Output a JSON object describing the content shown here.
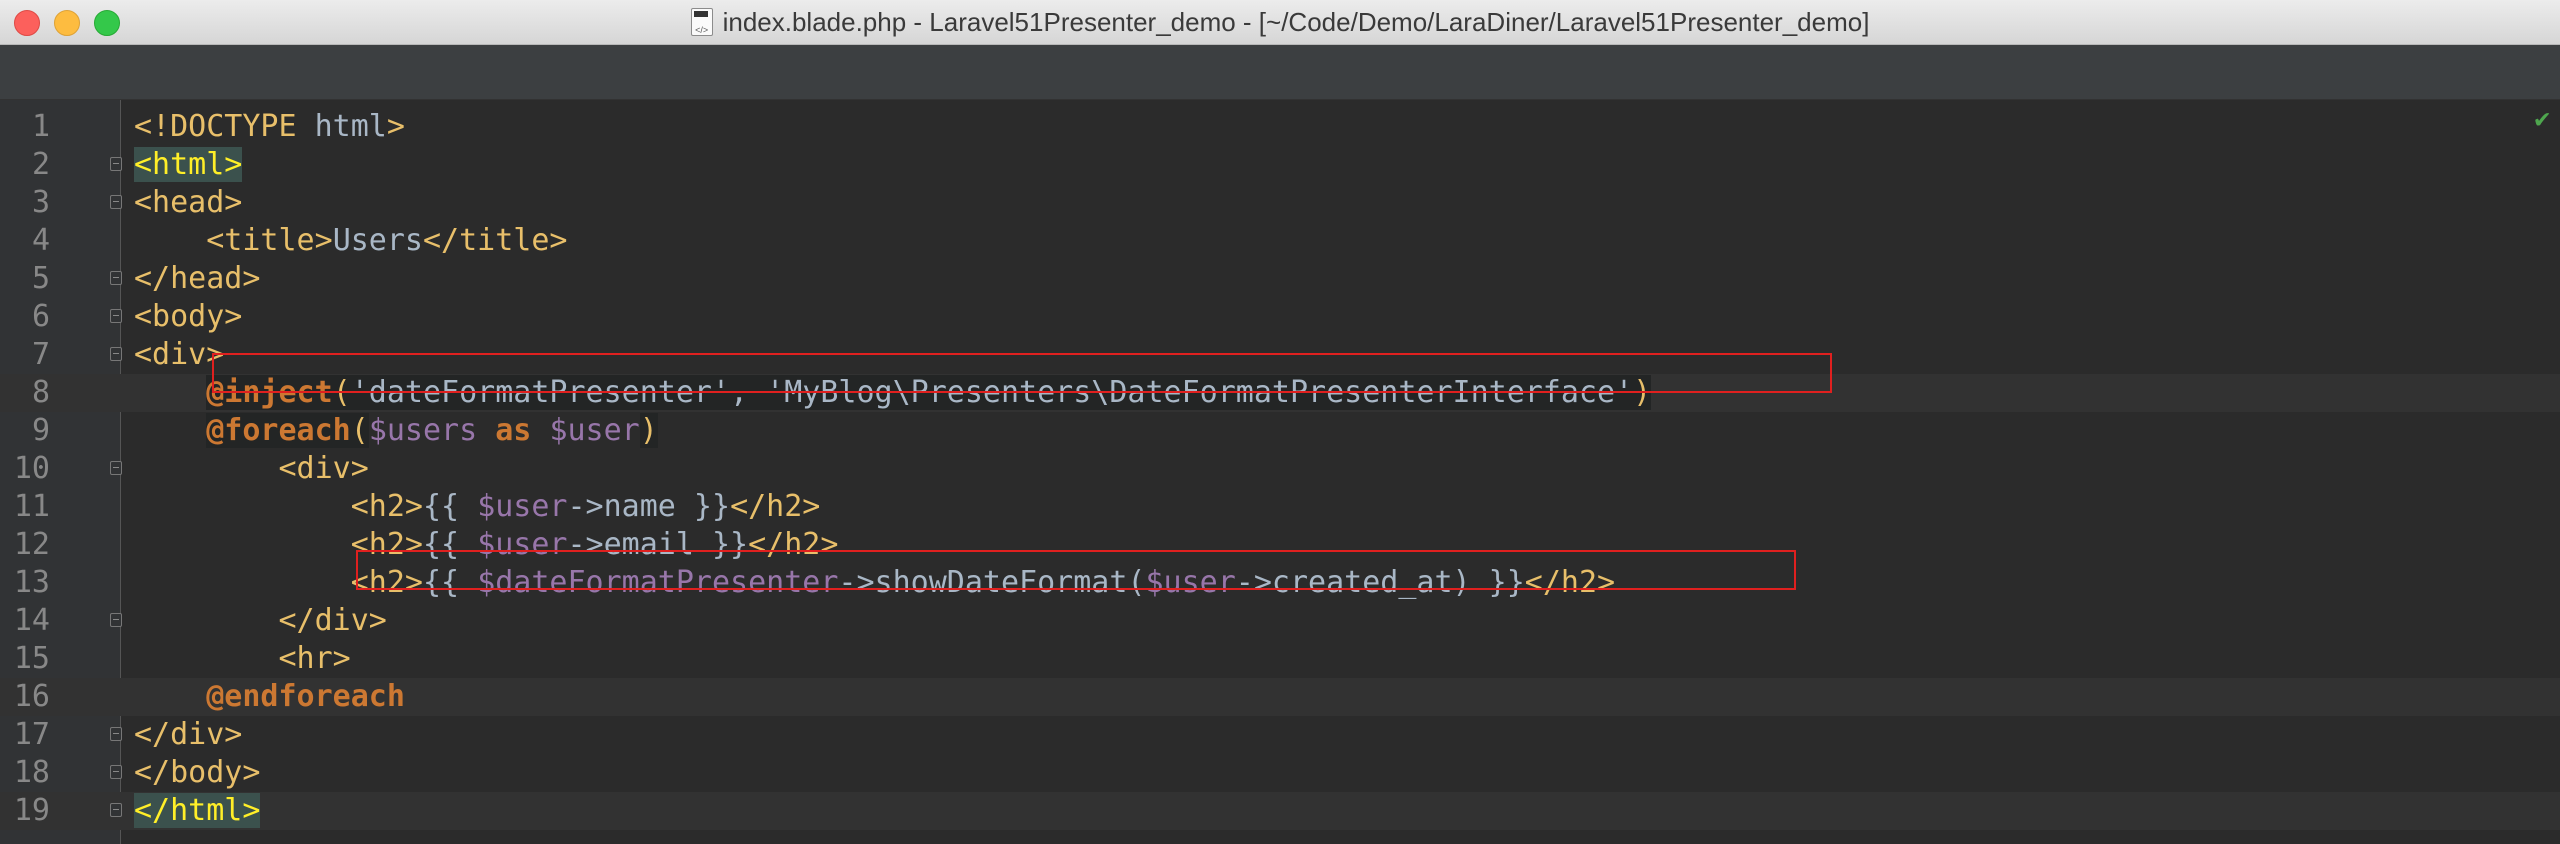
{
  "window": {
    "title": "index.blade.php - Laravel51Presenter_demo - [~/Code/Demo/LaraDiner/Laravel51Presenter_demo]"
  },
  "icons": {
    "file_icon": "php-file-icon",
    "status_icon": "check-icon"
  },
  "colors": {
    "tag": "#e8bf6a",
    "directive": "#cc7832",
    "variable": "#9876aa",
    "text": "#a9b7c6",
    "highlight_box": "#e0201f"
  },
  "editor": {
    "lines": [
      {
        "n": "1",
        "tokens": [
          [
            "tag",
            "<!DOCTYPE "
          ],
          [
            "punc",
            "html"
          ],
          [
            "tag",
            ">"
          ]
        ]
      },
      {
        "n": "2",
        "tokens": [
          [
            "match",
            "<html>"
          ]
        ]
      },
      {
        "n": "3",
        "tokens": [
          [
            "tag",
            "<head>"
          ]
        ]
      },
      {
        "n": "4",
        "tokens": [
          [
            "punc",
            "    "
          ],
          [
            "tag",
            "<title>"
          ],
          [
            "punc",
            "Users"
          ],
          [
            "tag",
            "</title>"
          ]
        ]
      },
      {
        "n": "5",
        "tokens": [
          [
            "tag",
            "</head>"
          ]
        ]
      },
      {
        "n": "6",
        "tokens": [
          [
            "tag",
            "<body>"
          ]
        ]
      },
      {
        "n": "7",
        "tokens": [
          [
            "tag",
            "<div>"
          ]
        ]
      },
      {
        "n": "8",
        "tokens": [
          [
            "punc",
            "    "
          ],
          [
            "dir",
            "@inject"
          ],
          [
            "paren",
            "("
          ],
          [
            "str",
            "'dateFormatPresenter', 'MyBlog\\Presenters\\DateFormatPresenterInterface'"
          ],
          [
            "paren",
            ")"
          ]
        ]
      },
      {
        "n": "9",
        "tokens": [
          [
            "punc",
            "    "
          ],
          [
            "dir",
            "@foreach"
          ],
          [
            "paren",
            "("
          ],
          [
            "var",
            "$users"
          ],
          [
            "punc",
            " "
          ],
          [
            "kw",
            "as"
          ],
          [
            "punc",
            " "
          ],
          [
            "var",
            "$user"
          ],
          [
            "paren",
            ")"
          ]
        ]
      },
      {
        "n": "10",
        "tokens": [
          [
            "punc",
            "        "
          ],
          [
            "tag",
            "<div>"
          ]
        ]
      },
      {
        "n": "11",
        "tokens": [
          [
            "punc",
            "            "
          ],
          [
            "tag",
            "<h2>"
          ],
          [
            "punc",
            "{{ "
          ],
          [
            "var",
            "$user"
          ],
          [
            "punc",
            "->name }}"
          ],
          [
            "tag",
            "</h2>"
          ]
        ]
      },
      {
        "n": "12",
        "tokens": [
          [
            "punc",
            "            "
          ],
          [
            "tag",
            "<h2>"
          ],
          [
            "punc",
            "{{ "
          ],
          [
            "var",
            "$user"
          ],
          [
            "punc",
            "->email }}"
          ],
          [
            "tag",
            "</h2>"
          ]
        ]
      },
      {
        "n": "13",
        "tokens": [
          [
            "punc",
            "            "
          ],
          [
            "tag",
            "<h2>"
          ],
          [
            "punc",
            "{{ "
          ],
          [
            "var",
            "$dateFormatPresenter"
          ],
          [
            "punc",
            "->showDateFormat("
          ],
          [
            "var",
            "$user"
          ],
          [
            "punc",
            "->created_at) }}"
          ],
          [
            "tag",
            "</h2>"
          ]
        ]
      },
      {
        "n": "14",
        "tokens": [
          [
            "punc",
            "        "
          ],
          [
            "tag",
            "</div>"
          ]
        ]
      },
      {
        "n": "15",
        "tokens": [
          [
            "punc",
            "        "
          ],
          [
            "tag",
            "<hr>"
          ]
        ]
      },
      {
        "n": "16",
        "tokens": [
          [
            "punc",
            "    "
          ],
          [
            "dir",
            "@endforeach"
          ]
        ]
      },
      {
        "n": "17",
        "tokens": [
          [
            "tag",
            "</div>"
          ]
        ]
      },
      {
        "n": "18",
        "tokens": [
          [
            "tag",
            "</body>"
          ]
        ]
      },
      {
        "n": "19",
        "tokens": [
          [
            "match",
            "</html>"
          ]
        ]
      }
    ]
  }
}
